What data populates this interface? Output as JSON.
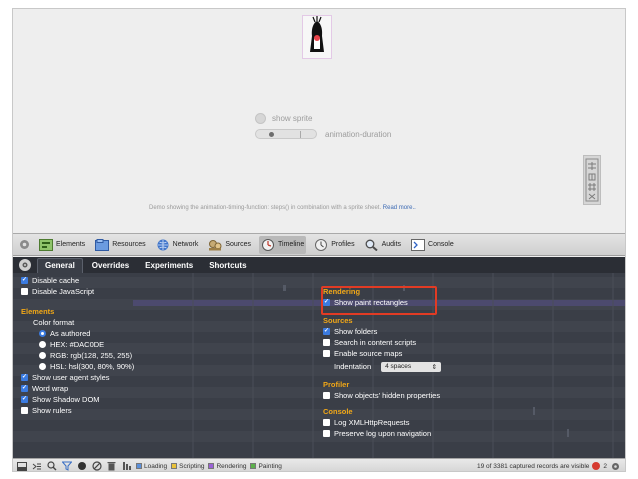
{
  "demo": {
    "show_sprite_label": "show sprite",
    "duration_label": "animation-duration",
    "caption_prefix": "Demo showing the animation-timing-function: steps() in combination with a sprite sheet.",
    "caption_link": "Read more.."
  },
  "toolbar": {
    "items": [
      {
        "label": "Elements",
        "icon": "elements-icon"
      },
      {
        "label": "Resources",
        "icon": "resources-icon"
      },
      {
        "label": "Network",
        "icon": "network-icon"
      },
      {
        "label": "Sources",
        "icon": "sources-icon"
      },
      {
        "label": "Timeline",
        "icon": "timeline-icon",
        "active": true
      },
      {
        "label": "Profiles",
        "icon": "profiles-icon"
      },
      {
        "label": "Audits",
        "icon": "audits-icon"
      },
      {
        "label": "Console",
        "icon": "console-icon"
      }
    ]
  },
  "settings": {
    "tabs": [
      {
        "label": "General",
        "active": true
      },
      {
        "label": "Overrides"
      },
      {
        "label": "Experiments"
      },
      {
        "label": "Shortcuts"
      }
    ],
    "left": {
      "disable_cache": "Disable cache",
      "disable_js": "Disable JavaScript",
      "elements_heading": "Elements",
      "color_format": "Color format",
      "as_authored": "As authored",
      "hex": "HEX: #DAC0DE",
      "rgb": "RGB: rgb(128, 255, 255)",
      "hsl": "HSL: hsl(300, 80%, 90%)",
      "user_agent_styles": "Show user agent styles",
      "word_wrap": "Word wrap",
      "shadow_dom": "Show Shadow DOM",
      "rulers": "Show rulers"
    },
    "right": {
      "rendering_heading": "Rendering",
      "paint_rectangles": "Show paint rectangles",
      "sources_heading": "Sources",
      "show_folders": "Show folders",
      "search_content_scripts": "Search in content scripts",
      "enable_source_maps": "Enable source maps",
      "indentation_label": "Indentation",
      "indentation_value": "4 spaces",
      "profiler_heading": "Profiler",
      "hidden_properties": "Show objects' hidden properties",
      "console_heading": "Console",
      "log_xhr": "Log XMLHttpRequests",
      "preserve_log": "Preserve log upon navigation"
    }
  },
  "statusbar": {
    "categories": [
      {
        "label": "Loading",
        "color": "#5b8fd9"
      },
      {
        "label": "Scripting",
        "color": "#e9c23a"
      },
      {
        "label": "Rendering",
        "color": "#9a62d6"
      },
      {
        "label": "Painting",
        "color": "#5bb04a"
      }
    ],
    "records": "19 of 3381 captured records are visible",
    "errors": "2"
  },
  "colors": {
    "panel_bg": "#3a3e47",
    "heading": "#f2a817",
    "highlight": "#e23b24"
  }
}
